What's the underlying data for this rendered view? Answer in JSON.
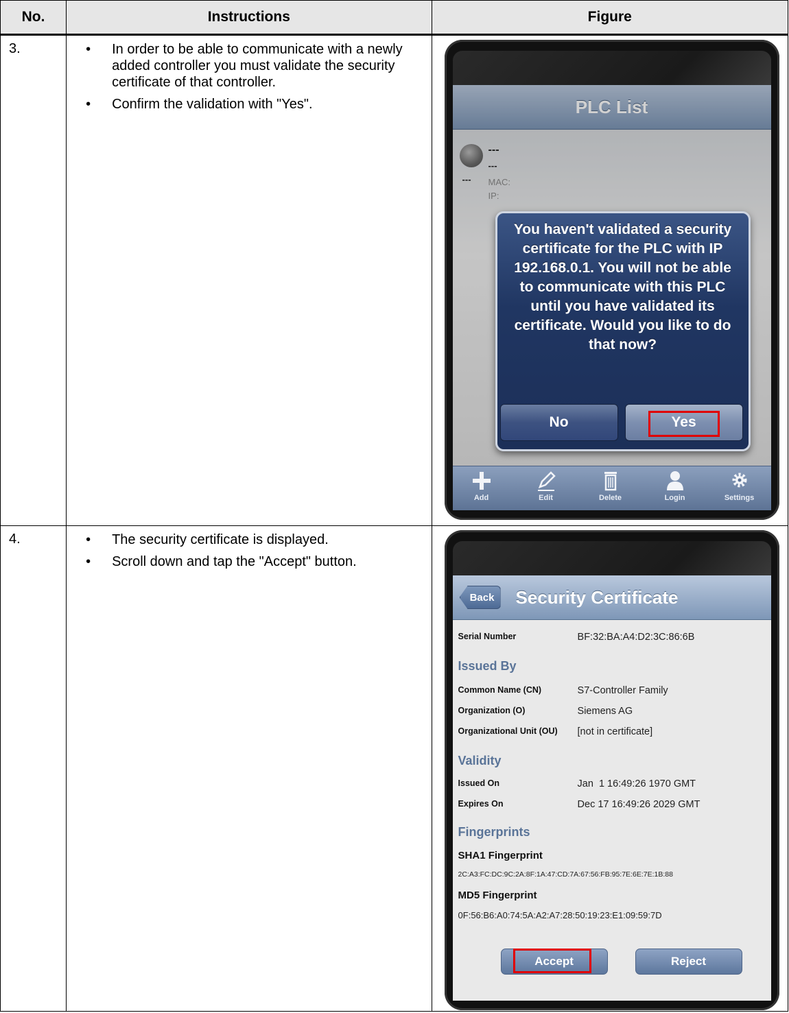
{
  "table": {
    "headers": [
      "No.",
      "Instructions",
      "Figure"
    ]
  },
  "steps": [
    {
      "number": "3.",
      "bullets": [
        "In order to be able to communicate with a newly added controller you must validate the security certificate of that controller.",
        "Confirm the validation with \"Yes\"."
      ],
      "screen": {
        "title": "PLC List",
        "list_item": {
          "name": "---",
          "sub": "---",
          "side": "---",
          "mac": "MAC:",
          "ip": "IP:"
        },
        "alert": {
          "message": "You haven't validated a security certificate for the PLC with IP 192.168.0.1. You will not be able to communicate with this PLC until you have validated its certificate. Would you like to do that now?",
          "no_label": "No",
          "yes_label": "Yes"
        },
        "tabs": [
          "Add",
          "Edit",
          "Delete",
          "Login",
          "Settings"
        ]
      }
    },
    {
      "number": "4.",
      "bullets": [
        "The security certificate is displayed.",
        "Scroll down and tap the \"Accept\" button."
      ],
      "screen": {
        "back_label": "Back",
        "title": "Security Certificate",
        "serial_label": "Serial Number",
        "serial_value": "BF:32:BA:A4:D2:3C:86:6B",
        "issued_by_heading": "Issued By",
        "cn_label": "Common Name (CN)",
        "cn_value": "S7-Controller Family",
        "o_label": "Organization (O)",
        "o_value": "Siemens AG",
        "ou_label": "Organizational Unit (OU)",
        "ou_value": "[not in certificate]",
        "validity_heading": "Validity",
        "issued_on_label": "Issued On",
        "issued_on_value": "Jan  1 16:49:26 1970 GMT",
        "expires_on_label": "Expires On",
        "expires_on_value": "Dec 17 16:49:26 2029 GMT",
        "fingerprints_heading": "Fingerprints",
        "sha1_label": "SHA1 Fingerprint",
        "sha1_value": "2C:A3:FC:DC:9C:2A:8F:1A:47:CD:7A:67:56:FB:95:7E:6E:7E:1B:88",
        "md5_label": "MD5 Fingerprint",
        "md5_value": "0F:56:B6:A0:74:5A:A2:A7:28:50:19:23:E1:09:59:7D",
        "accept_label": "Accept",
        "reject_label": "Reject"
      }
    }
  ],
  "colors": {
    "highlight": "#e00000",
    "nav_blue": "#7e97b7",
    "alert_blue": "#203662",
    "section_heading": "#5a7498"
  }
}
